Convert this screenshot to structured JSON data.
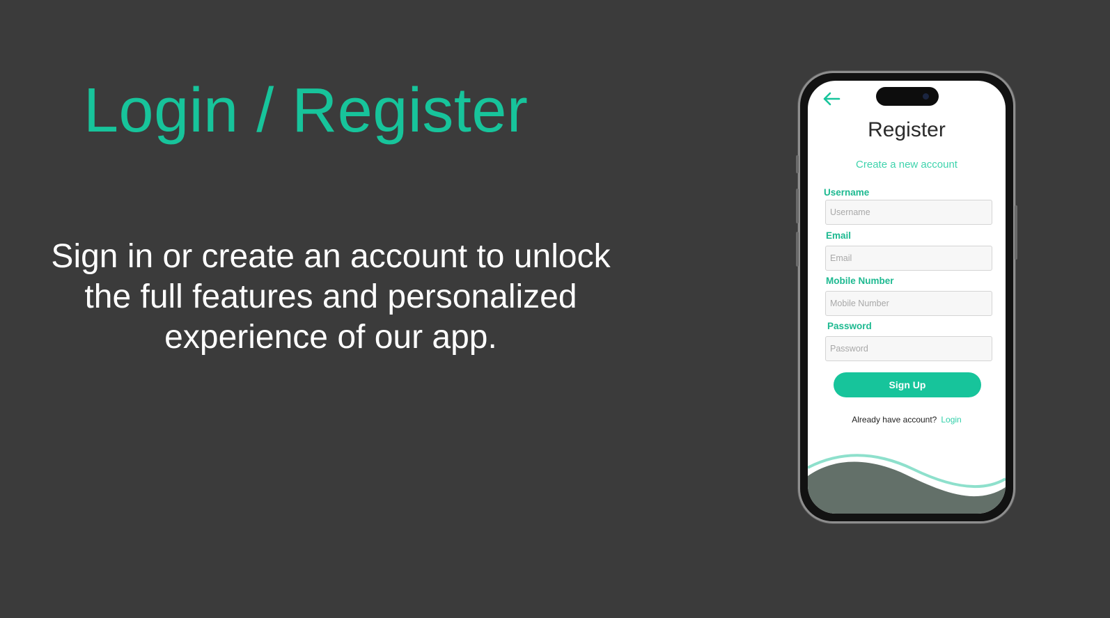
{
  "slide": {
    "title": "Login / Register",
    "description": "Sign in or create an account to unlock the full features and personalized experience of our app."
  },
  "phone": {
    "back_icon": "arrow-left-icon",
    "register_title": "Register",
    "register_subtitle": "Create a new account",
    "fields": [
      {
        "label": "Username",
        "placeholder": "Username"
      },
      {
        "label": "Email",
        "placeholder": "Email"
      },
      {
        "label": "Mobile Number",
        "placeholder": "Mobile Number"
      },
      {
        "label": "Password",
        "placeholder": "Password"
      }
    ],
    "signup_label": "Sign Up",
    "account_question": "Already have account?",
    "login_label": "Login"
  },
  "colors": {
    "background": "#3b3b3b",
    "accent": "#17c49b",
    "wave_dark": "#637069",
    "wave_light": "#8ee0cc"
  }
}
